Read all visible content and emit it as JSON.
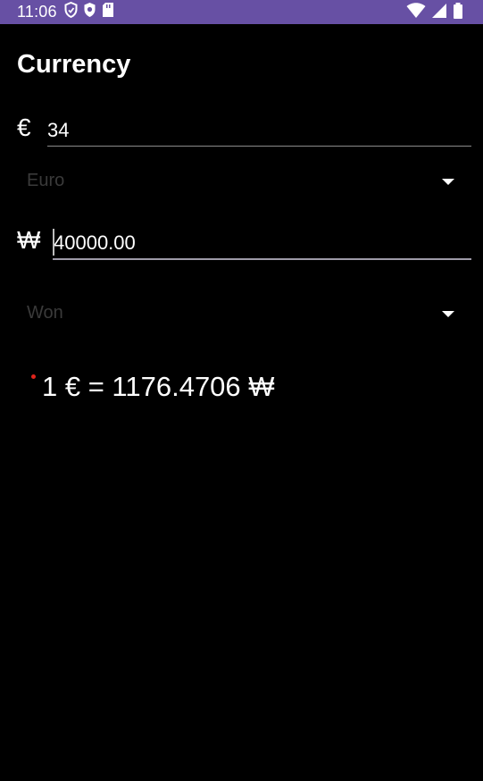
{
  "status_bar": {
    "time": "11:06",
    "background": "#6750a4",
    "left_icons": [
      "shield-icon",
      "security-icon",
      "sd-card-icon"
    ],
    "right_icons": [
      "wifi-icon",
      "cell-signal-icon",
      "battery-icon"
    ]
  },
  "screen": {
    "title": "Currency"
  },
  "from": {
    "symbol": "€",
    "amount": "34",
    "currency": "Euro"
  },
  "to": {
    "symbol": "₩",
    "amount": "40000.00",
    "currency": "Won"
  },
  "result": {
    "rate_text": "1 € = 1176.4706 ₩"
  },
  "colors": {
    "accent": "#6750a4",
    "background": "#000000",
    "text": "#ffffff",
    "spinner_text": "#3a3a3a",
    "dot": "#e0241b"
  }
}
